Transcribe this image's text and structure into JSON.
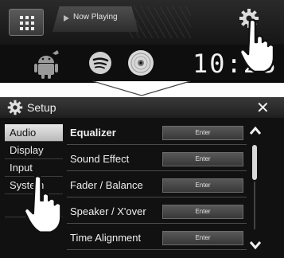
{
  "home": {
    "now_playing_label": "Now Playing",
    "clock": "10:28",
    "icons": [
      "apps-grid-icon",
      "android-auto-icon",
      "spotify-icon",
      "disc-icon",
      "settings-gear-icon"
    ]
  },
  "setup": {
    "title": "Setup",
    "close_label": "✕",
    "tabs": [
      {
        "label": "Audio",
        "active": true
      },
      {
        "label": "Display",
        "active": false
      },
      {
        "label": "Input",
        "active": false
      },
      {
        "label": "System",
        "active": false
      }
    ],
    "items": [
      {
        "label": "Equalizer",
        "button": "Enter"
      },
      {
        "label": "Sound Effect",
        "button": "Enter"
      },
      {
        "label": "Fader / Balance",
        "button": "Enter"
      },
      {
        "label": "Speaker / X'over",
        "button": "Enter"
      },
      {
        "label": "Time Alignment",
        "button": "Enter"
      }
    ]
  },
  "colors": {
    "panel_bg": "#111111",
    "active_tab": "#d0d0d0",
    "text": "#f0f0f0"
  }
}
